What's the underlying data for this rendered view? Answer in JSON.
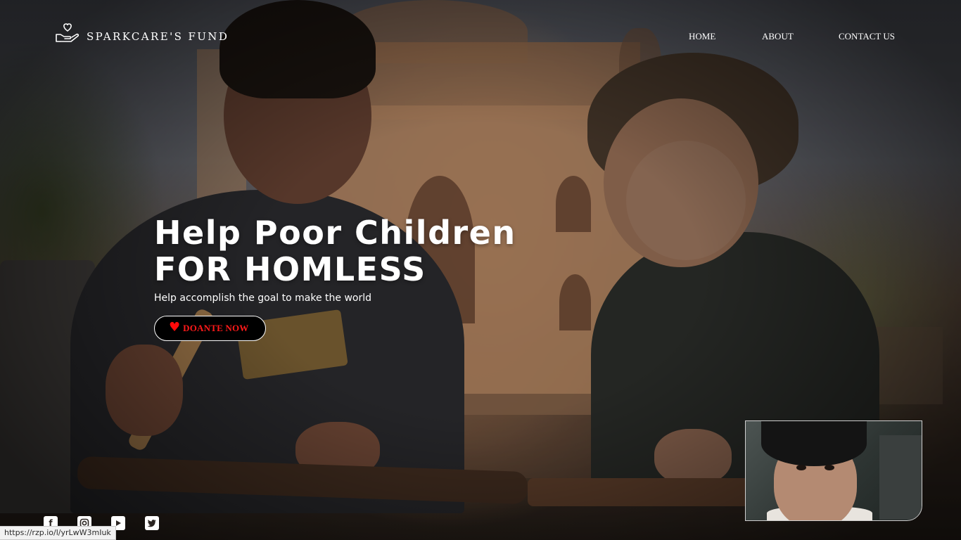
{
  "header": {
    "brand_name": "SPARKCARE'S FUND",
    "logo_icon": "hand-heart-icon",
    "nav": {
      "home": "HOME",
      "about": "ABOUT",
      "contact": "CONTACT US"
    }
  },
  "hero": {
    "title_line1": "Help Poor Children",
    "title_line2": "FOR HOMLESS",
    "subtitle": "Help accomplish the goal to make the world",
    "donate_label": "DOANTE NOW",
    "donate_icon": "heart-icon"
  },
  "social": {
    "icons": [
      "facebook-icon",
      "instagram-icon",
      "youtube-icon",
      "twitter-icon"
    ]
  },
  "status_bar": {
    "url": "https://rzp.io/l/yrLwW3mIuk"
  },
  "colors": {
    "text": "#ffffff",
    "donate_text": "#ff1a1a",
    "donate_bg": "#000000"
  }
}
